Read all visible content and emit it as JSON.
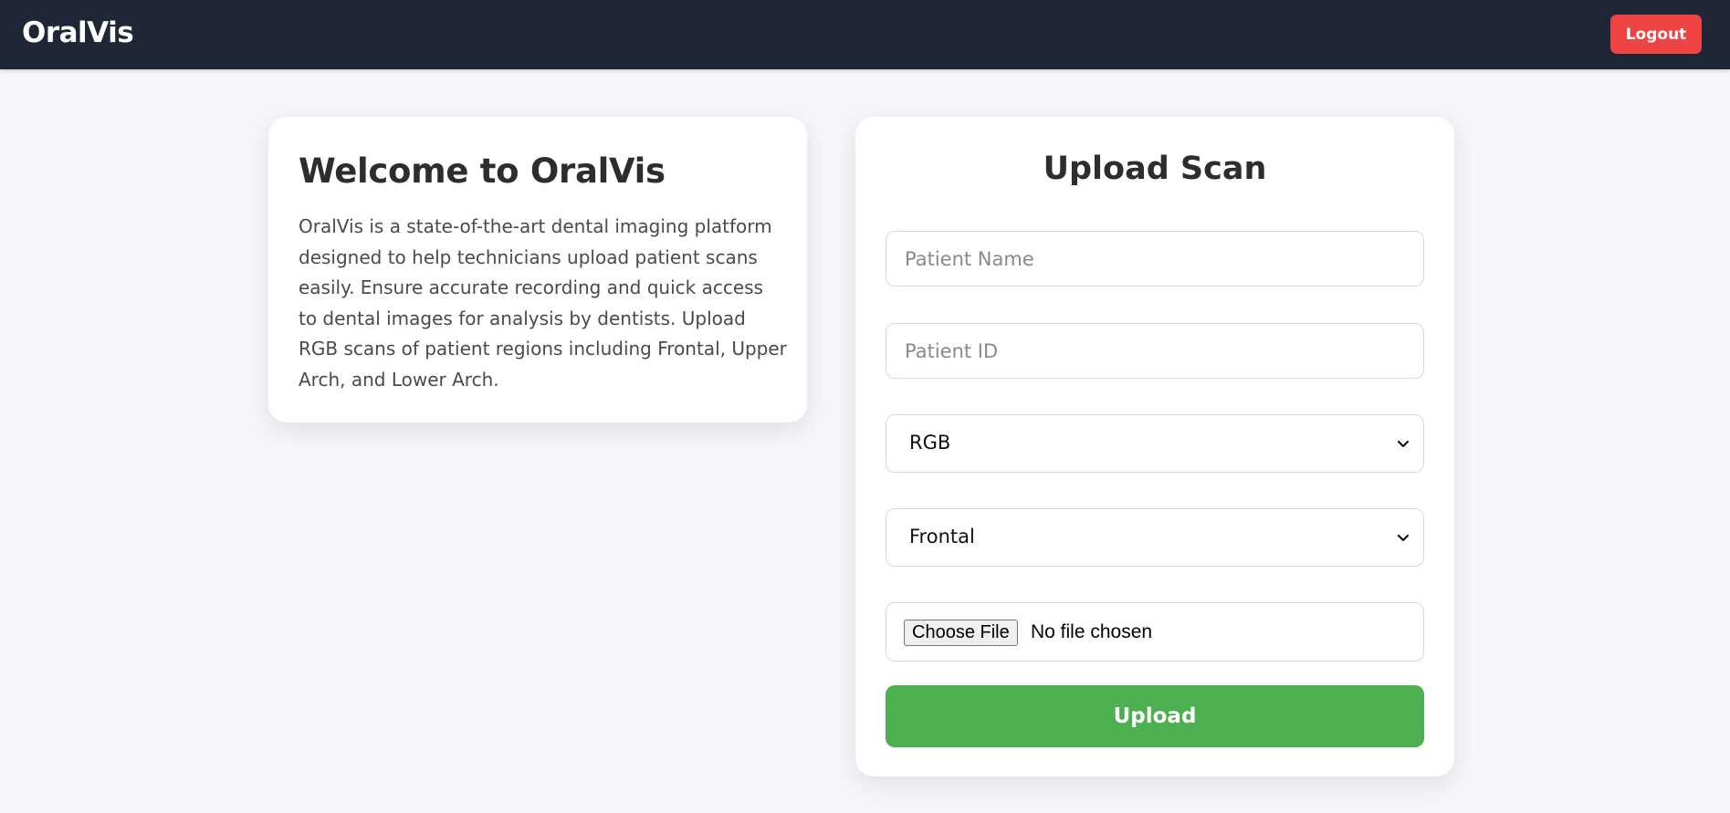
{
  "navbar": {
    "brand": "OralVis",
    "logout_label": "Logout",
    "logout_color": "#ef4444",
    "background_color": "#1f2737"
  },
  "welcome": {
    "title": "Welcome to OralVis",
    "description": "OralVis is a state-of-the-art dental imaging platform designed to help technicians upload patient scans easily. Ensure accurate recording and quick access to dental images for analysis by dentists. Upload RGB scans of patient regions including Frontal, Upper Arch, and Lower Arch."
  },
  "upload": {
    "title": "Upload Scan",
    "patient_name": {
      "value": "",
      "placeholder": "Patient Name"
    },
    "patient_id": {
      "value": "",
      "placeholder": "Patient ID"
    },
    "scan_type": {
      "selected": "RGB"
    },
    "region": {
      "selected": "Frontal"
    },
    "file": {
      "button_label": "Choose File",
      "status": "No file chosen"
    },
    "submit_label": "Upload",
    "submit_color": "#4caf50"
  }
}
